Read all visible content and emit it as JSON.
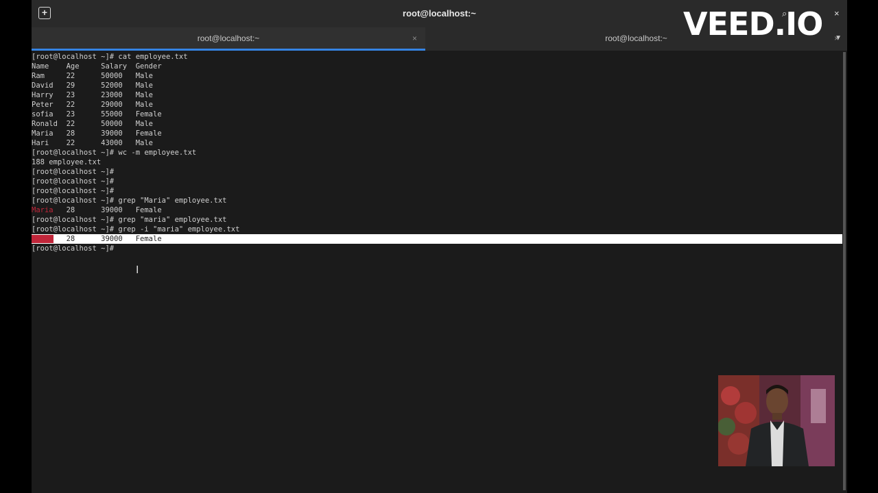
{
  "window": {
    "title": "root@localhost:~",
    "new_tab_icon": "new-tab-icon",
    "search_icon": "⌕",
    "menu_icon": "≡",
    "close_icon": "×"
  },
  "tabs": [
    {
      "label": "root@localhost:~",
      "close": "×",
      "active": true
    },
    {
      "label": "root@localhost:~",
      "close": "×",
      "active": false
    }
  ],
  "tab_menu_icon": "▼",
  "terminal_lines": [
    {
      "text": "[root@localhost ~]# cat employee.txt"
    },
    {
      "text": "Name    Age     Salary  Gender"
    },
    {
      "text": "Ram     22      50000   Male"
    },
    {
      "text": "David   29      52000   Male"
    },
    {
      "text": "Harry   23      23000   Male"
    },
    {
      "text": "Peter   22      29000   Male"
    },
    {
      "text": "sofia   23      55000   Female"
    },
    {
      "text": "Ronald  22      50000   Male"
    },
    {
      "text": "Maria   28      39000   Female"
    },
    {
      "text": "Hari    22      43000   Male"
    },
    {
      "text": "[root@localhost ~]# wc -m employee.txt"
    },
    {
      "text": "188 employee.txt"
    },
    {
      "text": "[root@localhost ~]#"
    },
    {
      "text": "[root@localhost ~]#"
    },
    {
      "text": "[root@localhost ~]#"
    },
    {
      "text": "[root@localhost ~]# grep \"Maria\" employee.txt"
    },
    {
      "match": "Maria",
      "text": "   28      39000   Female"
    },
    {
      "text": "[root@localhost ~]# grep \"maria\" employee.txt"
    },
    {
      "text": "[root@localhost ~]# grep -i \"maria\" employee.txt"
    },
    {
      "match": "Maria",
      "text": "   28      39000   Female",
      "highlighted": true
    },
    {
      "text": "[root@localhost ~]#"
    }
  ],
  "watermark": "VEED.IO",
  "colors": {
    "terminal_bg": "#1b1b1b",
    "match_red": "#c0263a",
    "tab_indicator": "#3584e4"
  }
}
